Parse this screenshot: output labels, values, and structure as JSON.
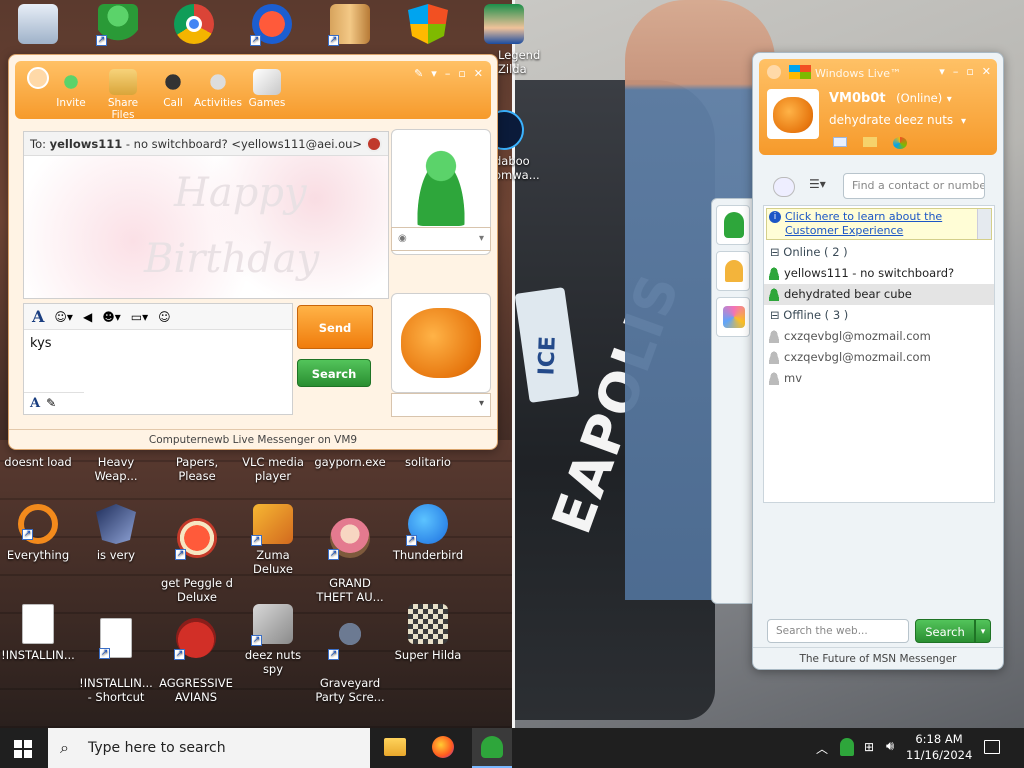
{
  "desktop_icons": [
    {
      "label": "",
      "icon": "recycle-bin-icon"
    },
    {
      "label": "",
      "icon": "messenger-people-icon"
    },
    {
      "label": "",
      "icon": "chrome-icon"
    },
    {
      "label": "",
      "icon": "peggle-p-icon"
    },
    {
      "label": "",
      "icon": "archive-icon"
    },
    {
      "label": "",
      "icon": "windows-shield-icon"
    },
    {
      "label": "Legend\nZilda",
      "icon": "zelda-character-icon"
    },
    {
      "label": "daboo\nomwa...",
      "icon": "shma-icon"
    },
    {
      "label": "doesnt load",
      "icon": ""
    },
    {
      "label": "Heavy\nWeap...",
      "icon": ""
    },
    {
      "label": "Papers, Please",
      "icon": ""
    },
    {
      "label": "VLC media\nplayer",
      "icon": ""
    },
    {
      "label": "gayporn.exe",
      "icon": ""
    },
    {
      "label": "solitario",
      "icon": ""
    },
    {
      "label": "Everything",
      "icon": "everything-search-icon"
    },
    {
      "label": "is very",
      "icon": "mvp-icon"
    },
    {
      "label": "get Peggle d\nDeluxe",
      "icon": "peggle-icon"
    },
    {
      "label": "Zuma Deluxe",
      "icon": "zuma-icon"
    },
    {
      "label": "GRAND\nTHEFT AU...",
      "icon": "anime-girl-icon"
    },
    {
      "label": "Thunderbird",
      "icon": "thunderbird-icon"
    },
    {
      "label": "!INSTALLIN...",
      "icon": "text-file-icon"
    },
    {
      "label": "!INSTALLIN...\n- Shortcut",
      "icon": "text-file-shortcut-icon"
    },
    {
      "label": "AGGRESSIVE\nAVIANS",
      "icon": "angry-bird-icon"
    },
    {
      "label": "deez nuts spy",
      "icon": "stacked-windows-icon"
    },
    {
      "label": "Graveyard\nParty Scre...",
      "icon": "graveyard-icon"
    },
    {
      "label": "Super Hilda",
      "icon": "pixel-dog-icon"
    }
  ],
  "chat": {
    "toolbar": [
      "Invite",
      "Share Files",
      "Call",
      "Activities",
      "Games"
    ],
    "to_prefix": "To:",
    "to_name": "yellows111",
    "to_detail": "- no switchboard? <yellows111@aei.ou>",
    "input_value": "kys",
    "send_label": "Send",
    "search_label": "Search",
    "status_text": "Computernewb Live Messenger on VM9",
    "background_text_1": "Happy",
    "background_text_2": "Birthday"
  },
  "messenger": {
    "title": "Windows Live™",
    "display_name": "VM0b0t",
    "status": "(Online)",
    "personal_message": "dehydrate deez nuts",
    "search_contacts_placeholder": "Find a contact or number",
    "info_link": "Click here to learn about the Customer Experience",
    "online_header": "Online ( 2 )",
    "online_contacts": [
      "yellows111 - no switchboard?",
      "dehydrated bear cube"
    ],
    "offline_header": "Offline ( 3 )",
    "offline_contacts": [
      "cxzqevbgl@mozmail.com",
      "cxzqevbgl@mozmail.com",
      "mv"
    ],
    "web_search_placeholder": "Search the web...",
    "web_search_button": "Search",
    "footer": "The Future of MSN Messenger"
  },
  "background_scene": {
    "plate_text": "ICE",
    "car_text": "EAPOLIS"
  },
  "taskbar": {
    "search_placeholder": "Type here to search",
    "time": "6:18 AM",
    "date": "11/16/2024"
  },
  "colors": {
    "accent_orange": "#f69a2b",
    "accent_green": "#2a8e31",
    "link_blue": "#1c56c6"
  }
}
